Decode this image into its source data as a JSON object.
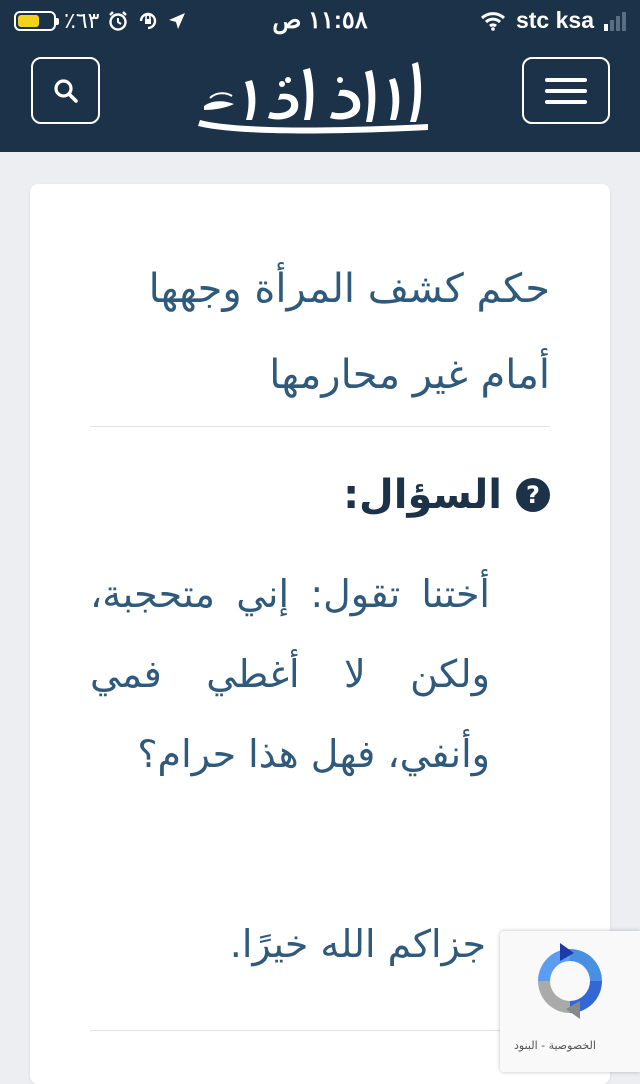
{
  "status_bar": {
    "battery_percent": "٪٦٣",
    "battery_level": 0.63,
    "time": "١١:٥٨ ص",
    "carrier": "stc ksa",
    "icons": [
      "alarm-icon",
      "rotation-lock-icon",
      "location-arrow-icon",
      "wifi-icon",
      "signal-icon"
    ]
  },
  "header": {
    "search_icon": "search-icon",
    "menu_icon": "hamburger-menu-icon",
    "background": "#1c3248"
  },
  "article": {
    "title": "حكم كشف المرأة وجهها أمام غير محارمها",
    "question_label": "السؤال:",
    "question_text": "أختنا تقول: إني متحجبة، ولكن لا أغطي فمي وأنفي، فهل هذا حرام؟",
    "thanks": "جزاكم الله خيرًا."
  },
  "recaptcha": {
    "links": "الخصوصية - البنود"
  },
  "colors": {
    "text_accent": "#2f5a7b",
    "navy": "#1c3248"
  }
}
